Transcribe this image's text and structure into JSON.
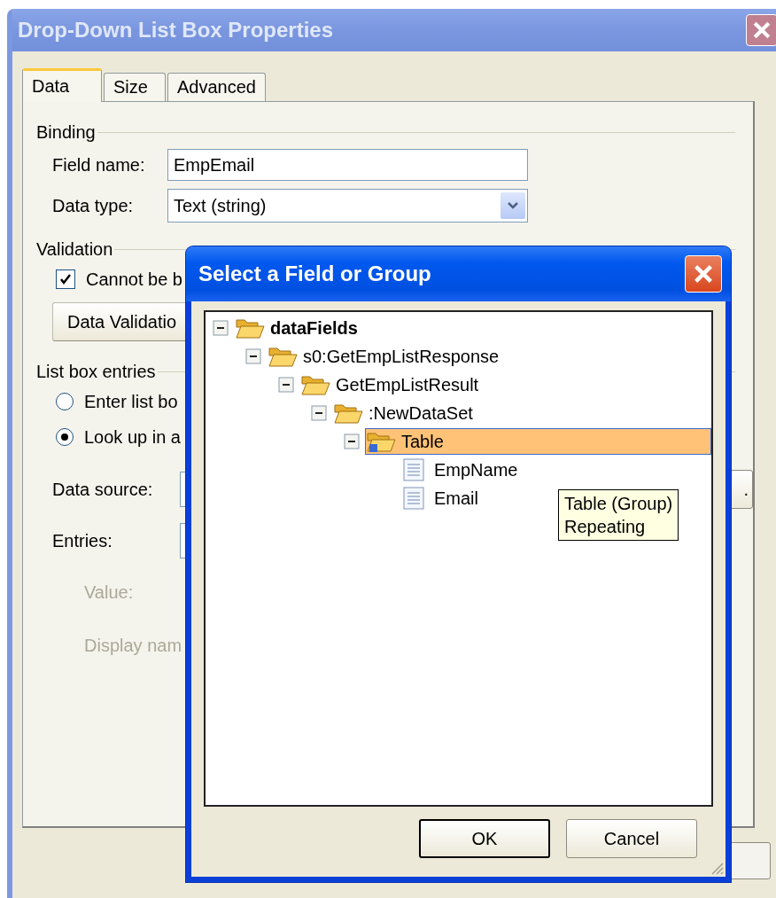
{
  "window": {
    "title": "Drop-Down List Box Properties"
  },
  "tabs": [
    {
      "label": "Data",
      "selected": true
    },
    {
      "label": "Size",
      "selected": false
    },
    {
      "label": "Advanced",
      "selected": false
    }
  ],
  "binding": {
    "heading": "Binding",
    "field_name": {
      "label": "Field name:",
      "value": "EmpEmail"
    },
    "data_type": {
      "label": "Data type:",
      "value": "Text (string)"
    }
  },
  "validation": {
    "heading": "Validation",
    "cannot_be_blank": {
      "label": "Cannot be b",
      "checked": true
    },
    "button": "Data Validatio"
  },
  "list_box_entries": {
    "heading": "List box entries",
    "options": [
      {
        "label": "Enter list bo",
        "selected": false
      },
      {
        "label": "Look up in a",
        "selected": true
      }
    ],
    "data_source": {
      "label": "Data source:",
      "button": "."
    },
    "entries": {
      "label": "Entries:"
    },
    "value": {
      "label": "Value:",
      "disabled": true
    },
    "display_name": {
      "label": "Display nam",
      "disabled": true
    }
  },
  "dialog": {
    "title": "Select a Field or Group",
    "tree": [
      {
        "label": "dataFields",
        "kind": "group",
        "expanded": true,
        "selected": false,
        "children": [
          {
            "label": "s0:GetEmpListResponse",
            "kind": "group",
            "expanded": true,
            "selected": false,
            "children": [
              {
                "label": "GetEmpListResult",
                "kind": "group",
                "expanded": true,
                "selected": false,
                "children": [
                  {
                    "label": ":NewDataSet",
                    "kind": "group",
                    "expanded": true,
                    "selected": false,
                    "children": [
                      {
                        "label": "Table",
                        "kind": "repeating",
                        "expanded": true,
                        "selected": true,
                        "children": [
                          {
                            "label": "EmpName",
                            "kind": "field",
                            "selected": false
                          },
                          {
                            "label": "Email",
                            "kind": "field",
                            "selected": false
                          }
                        ]
                      }
                    ]
                  }
                ]
              }
            ]
          }
        ]
      }
    ],
    "tooltip": [
      "Table (Group)",
      "Repeating"
    ],
    "buttons": [
      {
        "label": "OK",
        "default": true
      },
      {
        "label": "Cancel",
        "default": false
      }
    ]
  }
}
